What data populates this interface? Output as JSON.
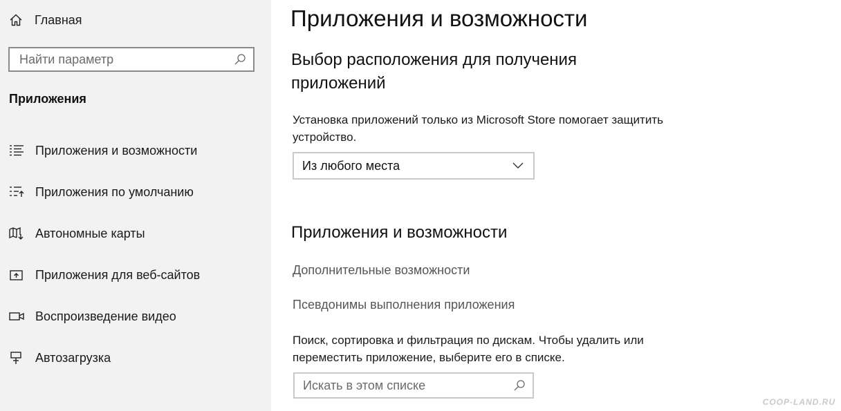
{
  "sidebar": {
    "home_label": "Главная",
    "search_placeholder": "Найти параметр",
    "section_title": "Приложения",
    "items": [
      {
        "label": "Приложения и возможности",
        "icon": "apps-features-icon"
      },
      {
        "label": "Приложения по умолчанию",
        "icon": "default-apps-icon"
      },
      {
        "label": "Автономные карты",
        "icon": "offline-maps-icon"
      },
      {
        "label": "Приложения для веб-сайтов",
        "icon": "apps-for-websites-icon"
      },
      {
        "label": "Воспроизведение видео",
        "icon": "video-playback-icon"
      },
      {
        "label": "Автозагрузка",
        "icon": "startup-icon"
      }
    ]
  },
  "main": {
    "title": "Приложения и возможности",
    "install_section_title": "Выбор расположения для получения приложений",
    "install_description": "Установка приложений только из Microsoft Store помогает защитить устройство.",
    "install_dropdown_value": "Из любого места",
    "apps_section_title": "Приложения и возможности",
    "link_optional_features": "Дополнительные возможности",
    "link_app_aliases": "Псевдонимы выполнения приложения",
    "list_description": "Поиск, сортировка и фильтрация по дискам. Чтобы удалить или переместить приложение, выберите его в списке.",
    "list_search_placeholder": "Искать в этом списке"
  },
  "watermark": "COOP-LAND.RU"
}
